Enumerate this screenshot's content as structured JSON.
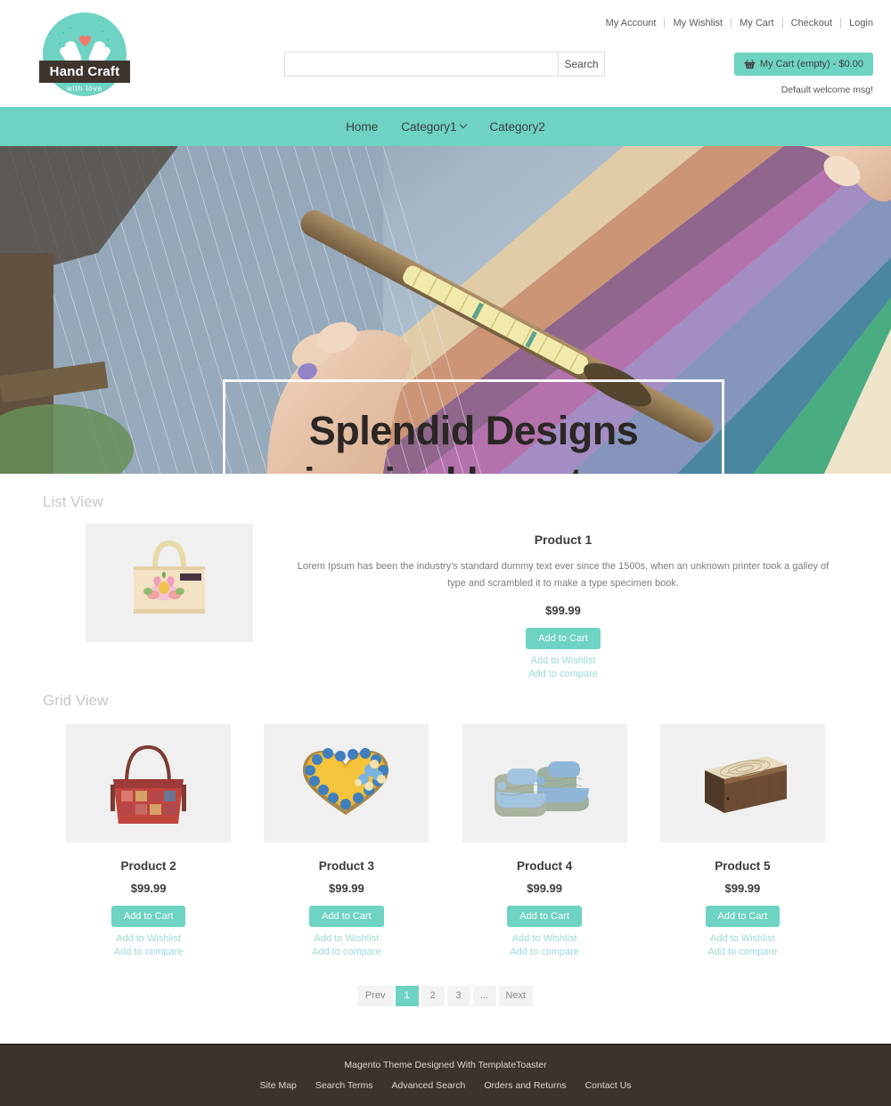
{
  "header": {
    "logo": {
      "title": "Hand Craft",
      "tagline": "with love",
      "icon": "hands-heart-icon"
    },
    "top_links": [
      {
        "label": "My Account"
      },
      {
        "label": "My Wishlist"
      },
      {
        "label": "My Cart"
      },
      {
        "label": "Checkout"
      },
      {
        "label": "Login"
      }
    ],
    "search": {
      "value": "",
      "placeholder": "",
      "button_label": "Search"
    },
    "cart": {
      "label": "My Cart (empty) - $0.00",
      "icon": "shopping-basket-icon"
    },
    "welcome_message": "Default welcome msg!"
  },
  "nav": {
    "items": [
      {
        "label": "Home",
        "has_dropdown": false
      },
      {
        "label": "Category1",
        "has_dropdown": true
      },
      {
        "label": "Category2",
        "has_dropdown": false
      }
    ]
  },
  "hero": {
    "line1": "Splendid Designs",
    "line2": "inspired by nature",
    "slides": 3,
    "active_slide": 2
  },
  "list_section": {
    "title": "List View",
    "product": {
      "name": "Product 1",
      "description": "Lorem Ipsum has been the industry's standard dummy text ever since the 1500s, when an unknown printer took a galley of type and scrambled it to make a type specimen book.",
      "price": "$99.99",
      "add_to_cart": "Add to Cart",
      "wishlist": "Add to Wishlist",
      "compare": "Add to compare",
      "image": "jute-tote-bag-flamingo-print"
    }
  },
  "grid_section": {
    "title": "Grid View",
    "products": [
      {
        "name": "Product 2",
        "price": "$99.99",
        "add_to_cart": "Add to Cart",
        "wishlist": "Add to Wishlist",
        "compare": "Add to compare",
        "image": "embroidered-patchwork-handbag"
      },
      {
        "name": "Product 3",
        "price": "$99.99",
        "add_to_cart": "Add to Cart",
        "wishlist": "Add to Wishlist",
        "compare": "Add to compare",
        "image": "blue-heart-shaped-decorative-box"
      },
      {
        "name": "Product 4",
        "price": "$99.99",
        "add_to_cart": "Add to Cart",
        "wishlist": "Add to Wishlist",
        "compare": "Add to compare",
        "image": "crochet-baby-booties"
      },
      {
        "name": "Product 5",
        "price": "$99.99",
        "add_to_cart": "Add to Cart",
        "wishlist": "Add to Wishlist",
        "compare": "Add to compare",
        "image": "carved-wooden-jewelry-box"
      }
    ]
  },
  "pagination": {
    "prev": "Prev",
    "next": "Next",
    "pages": [
      "1",
      "2",
      "3",
      "..."
    ],
    "active": "1"
  },
  "footer": {
    "credit": "Magento Theme Designed With TemplateToaster",
    "links": [
      {
        "label": "Site Map"
      },
      {
        "label": "Search Terms"
      },
      {
        "label": "Advanced Search"
      },
      {
        "label": "Orders and Returns"
      },
      {
        "label": "Contact Us"
      }
    ]
  },
  "colors": {
    "accent_teal": "#6ed3c3",
    "link_teal": "#9adcd0",
    "footer_dark": "#3b332d",
    "heart_coral": "#f4796d",
    "image_placeholder": "#f0f0f0"
  }
}
